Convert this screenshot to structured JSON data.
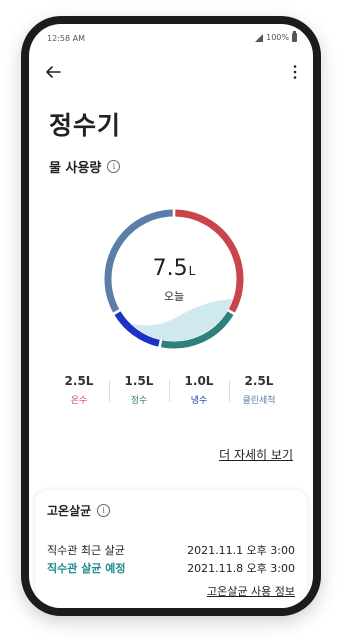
{
  "status_bar": {
    "time": "12:58 AM",
    "battery": "100%"
  },
  "header": {
    "title": "정수기"
  },
  "usage": {
    "section_title": "물 사용량",
    "total_value": "7.5",
    "total_unit": "L",
    "total_label": "오늘",
    "colors": {
      "hot": "#c9444b",
      "purified": "#2f7f7c",
      "cold": "#1a33c4",
      "clean": "#5a7ea8",
      "wave": "#cfe9ee"
    },
    "breakdown": [
      {
        "value": "2.5L",
        "label": "온수",
        "color": "#d44d4d",
        "liters": 2.5
      },
      {
        "value": "1.5L",
        "label": "정수",
        "color": "#2f7f7c",
        "liters": 1.5
      },
      {
        "value": "1.0L",
        "label": "냉수",
        "color": "#1a33c4",
        "liters": 1.0
      },
      {
        "value": "2.5L",
        "label": "클린세척",
        "color": "#5a7ea8",
        "liters": 2.5
      }
    ],
    "more_link": "더 자세히 보기"
  },
  "sterilization": {
    "title": "고온살균",
    "recent_label": "직수관 최근 살균",
    "recent_value": "2021.11.1 오후 3:00",
    "scheduled_label": "직수관 살균 예정",
    "scheduled_value": "2021.11.8 오후 3:00",
    "info_link": "고온살균 사용 정보"
  }
}
